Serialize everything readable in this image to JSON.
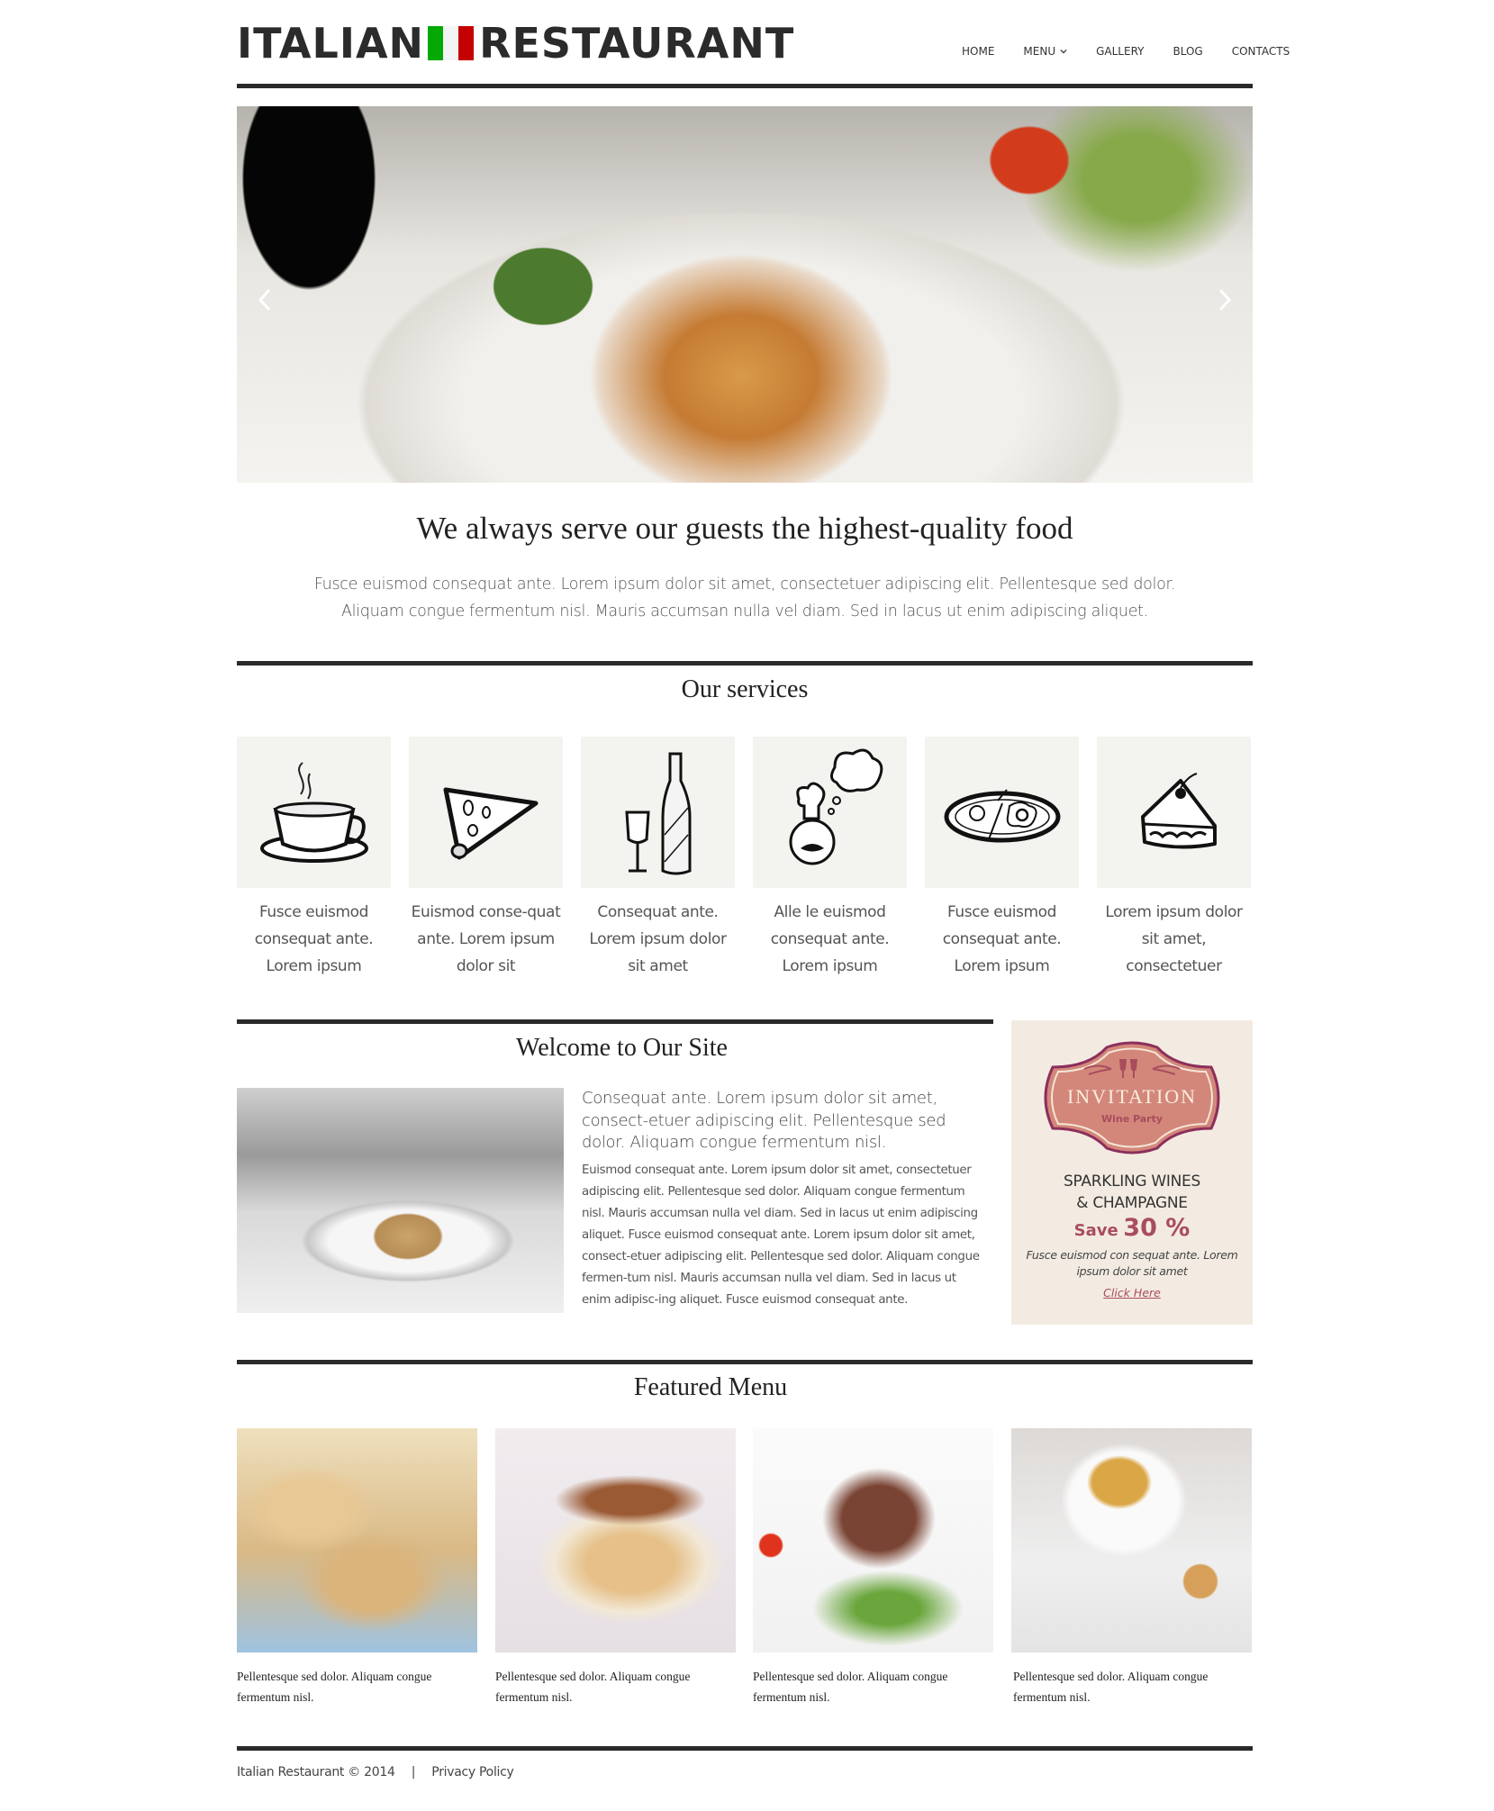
{
  "header": {
    "logo_left": "ITALIAN",
    "logo_right": "RESTAURANT",
    "flag_colors": [
      "#05a905",
      "#f4f4f4",
      "#c40000"
    ],
    "nav": [
      {
        "label": "HOME",
        "has_dropdown": false
      },
      {
        "label": "MENU",
        "has_dropdown": true
      },
      {
        "label": "GALLERY",
        "has_dropdown": false
      },
      {
        "label": "BLOG",
        "has_dropdown": false
      },
      {
        "label": "CONTACTS",
        "has_dropdown": false
      }
    ]
  },
  "slider": {
    "image": "pasta-dish-photo",
    "prev_icon": "chevron-left-icon",
    "next_icon": "chevron-right-icon"
  },
  "intro": {
    "title": "We always serve our guests the highest-quality food",
    "text": "Fusce euismod consequat ante. Lorem ipsum dolor sit amet, consectetuer adipiscing elit. Pellentesque sed dolor. Aliquam congue fermentum nisl. Mauris accumsan nulla vel diam. Sed in lacus ut enim adipiscing aliquet."
  },
  "services": {
    "title": "Our services",
    "items": [
      {
        "icon": "coffee-cup-icon",
        "caption": "Fusce euismod consequat ante. Lorem ipsum"
      },
      {
        "icon": "pizza-slice-icon",
        "caption": "Euismod conse-quat ante. Lorem ipsum dolor sit"
      },
      {
        "icon": "wine-bottle-icon",
        "caption": "Consequat ante. Lorem ipsum dolor sit amet"
      },
      {
        "icon": "chef-icon",
        "caption": "Alle le euismod consequat ante. Lorem ipsum"
      },
      {
        "icon": "plate-eggs-icon",
        "caption": "Fusce euismod consequat ante. Lorem ipsum"
      },
      {
        "icon": "cake-slice-icon",
        "caption": "Lorem ipsum dolor sit amet, consectetuer"
      }
    ]
  },
  "welcome": {
    "title": "Welcome to Our Site",
    "lead": "Consequat ante. Lorem ipsum dolor sit amet, consect-etuer adipiscing elit. Pellentesque sed dolor. Aliquam congue fermentum nisl.",
    "body": "Euismod consequat ante. Lorem ipsum dolor sit amet, consectetuer adipiscing elit. Pellentesque sed dolor. Aliquam congue fermentum nisl. Mauris accumsan nulla vel diam. Sed in lacus ut enim adipiscing aliquet. Fusce euismod consequat ante. Lorem ipsum dolor sit amet, consect-etuer adipiscing elit. Pellentesque sed dolor. Aliquam congue fermen-tum nisl. Mauris accumsan nulla vel diam. Sed in lacus ut enim adipisc-ing aliquet. Fusce euismod consequat ante."
  },
  "promo": {
    "badge_title": "INVITATION",
    "badge_subtitle": "Wine Party",
    "line1": "SPARKLING WINES",
    "line2": "& CHAMPAGNE",
    "save_label": "Save",
    "save_value": "30 %",
    "description": "Fusce euismod con sequat ante. Lorem ipsum dolor sit amet",
    "link": "Click Here",
    "accent": "#a84d5e",
    "badge_color": "#d3877a"
  },
  "featured": {
    "title": "Featured Menu",
    "items": [
      {
        "image": "biscotti-photo",
        "caption": "Pellentesque sed dolor. Aliquam congue fermentum nisl."
      },
      {
        "image": "tiramisu-photo",
        "caption": "Pellentesque sed dolor. Aliquam congue fermentum nisl."
      },
      {
        "image": "sliced-steak-photo",
        "caption": "Pellentesque sed dolor. Aliquam congue fermentum nisl."
      },
      {
        "image": "espresso-photo",
        "caption": "Pellentesque sed dolor. Aliquam congue fermentum nisl."
      }
    ]
  },
  "footer": {
    "copyright": "Italian Restaurant © 2014",
    "separator": "|",
    "privacy": "Privacy Policy"
  }
}
